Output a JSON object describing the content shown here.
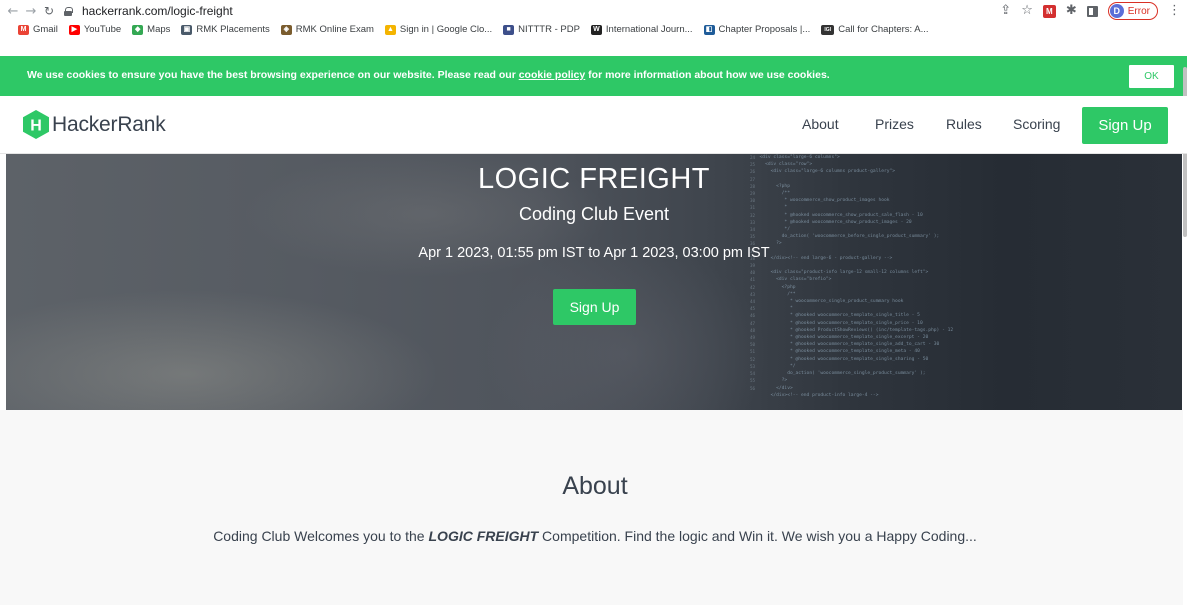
{
  "browser": {
    "url": "hackerrank.com/logic-freight",
    "profile_initial": "D",
    "profile_status": "Error",
    "extension_badge": "M",
    "bookmarks": [
      {
        "label": "Gmail",
        "icon": "gmail-icon",
        "color": "#EA4335",
        "glyph": "M"
      },
      {
        "label": "YouTube",
        "icon": "youtube-icon",
        "color": "#FF0000",
        "glyph": "▶"
      },
      {
        "label": "Maps",
        "icon": "maps-icon",
        "color": "#34A853",
        "glyph": "◆"
      },
      {
        "label": "RMK Placements",
        "icon": "rmk-placements-icon",
        "color": "#4a5a6a",
        "glyph": "▣"
      },
      {
        "label": "RMK Online Exam",
        "icon": "rmk-exam-icon",
        "color": "#7a5c2e",
        "glyph": "◈"
      },
      {
        "label": "Sign in | Google Clo...",
        "icon": "google-cloud-icon",
        "color": "#F4B400",
        "glyph": "▲"
      },
      {
        "label": "NITTTR - PDP",
        "icon": "nitttr-icon",
        "color": "#3d4f8a",
        "glyph": "■"
      },
      {
        "label": "International Journ...",
        "icon": "journal-icon",
        "color": "#222222",
        "glyph": "W"
      },
      {
        "label": "Chapter Proposals |...",
        "icon": "chapter-proposals-icon",
        "color": "#1f5c99",
        "glyph": "◧"
      },
      {
        "label": "Call for Chapters: A...",
        "icon": "call-for-chapters-icon",
        "color": "#333333",
        "glyph": "IGI"
      }
    ]
  },
  "cookie": {
    "text_before": "We use cookies to ensure you have the best browsing experience on our website. Please read our ",
    "link": "cookie policy",
    "text_after": " for more information about how we use cookies.",
    "ok_label": "OK"
  },
  "header": {
    "logo_text": "HackerRank",
    "nav": [
      "About",
      "Prizes",
      "Rules",
      "Scoring"
    ],
    "signup_label": "Sign Up"
  },
  "hero": {
    "title": "LOGIC FREIGHT",
    "subtitle": "Coding Club Event",
    "date_range": "Apr 1 2023, 01:55 pm IST to Apr 1 2023, 03:00 pm IST",
    "signup_label": "Sign Up"
  },
  "about": {
    "heading": "About",
    "text_before": "Coding Club Welcomes you to the ",
    "text_emphasis": "LOGIC FREIGHT",
    "text_after": " Competition. Find the logic and Win it. We wish you a Happy Coding..."
  },
  "colors": {
    "brand_green": "#2ec866",
    "text_dark": "#39424e",
    "hero_dark": "#262c34"
  }
}
